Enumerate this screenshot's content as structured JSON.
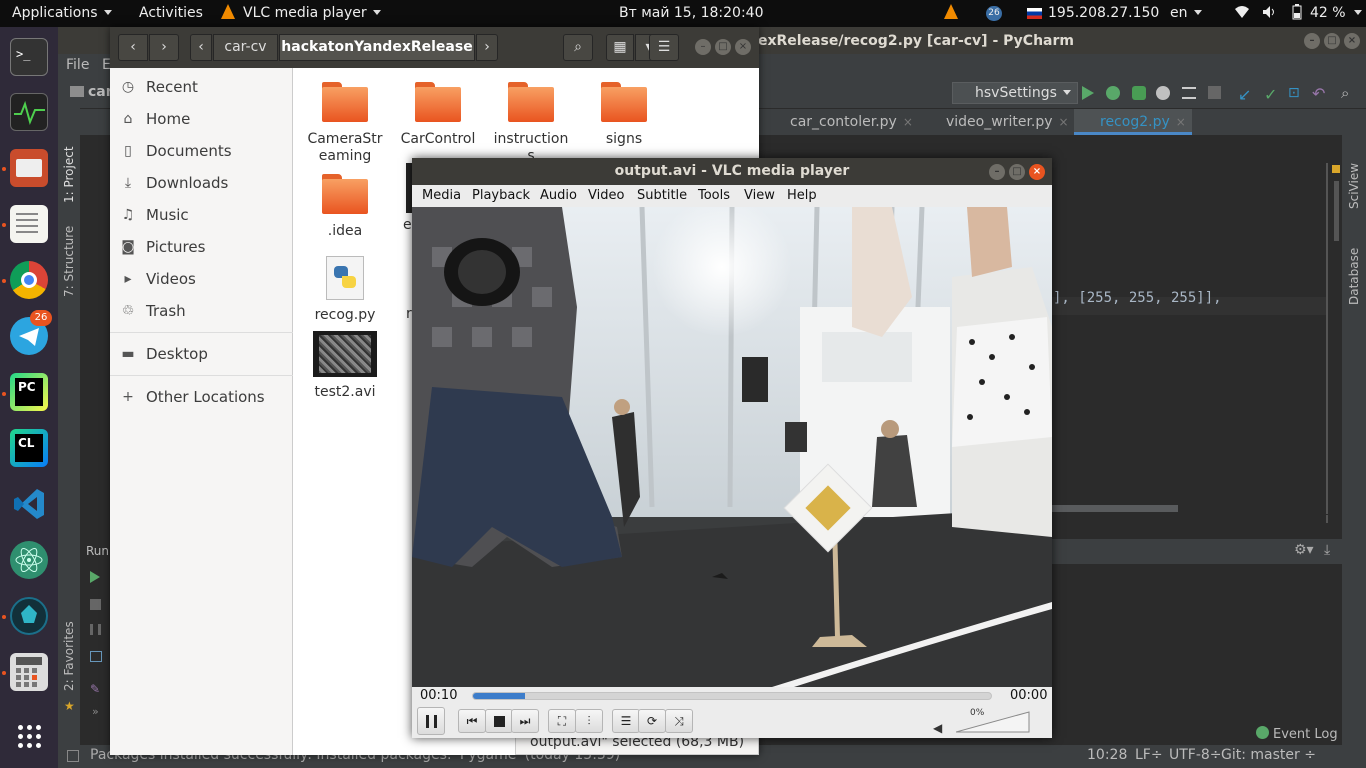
{
  "topbar": {
    "applications": "Applications",
    "activities": "Activities",
    "app_name": "VLC media player",
    "clock": "Вт май 15, 18:20:40",
    "telegram_badge": "26",
    "ip": "195.208.27.150",
    "lang": "en",
    "battery": "42 %"
  },
  "dock": {
    "telegram_badge": "26"
  },
  "pycharm": {
    "title": "exRelease/recog2.py [car-cv] - PyCharm",
    "menu": {
      "file": "File",
      "edit": "E"
    },
    "project_crumb": "car",
    "run_config": "hsvSettings",
    "tabs": [
      "car_contoler.py",
      "video_writer.py",
      "recog2.py"
    ],
    "code_line": "], [255, 255, 255]],",
    "left_tools": {
      "project": "1: Project",
      "structure": "7: Structure",
      "favorites": "2: Favorites",
      "run": "Run"
    },
    "right_tools": {
      "sciview": "SciView",
      "database": "Database"
    },
    "event_log": "Event Log",
    "status": {
      "message": "Packages installed successfully: Installed packages: 'Pygame' (today 15:39)",
      "position": "10:28",
      "line_sep": "LF÷",
      "encoding": "UTF-8÷",
      "git": "Git: master ÷"
    }
  },
  "nautilus": {
    "path": [
      "car-cv",
      "hackatonYandexRelease"
    ],
    "sidebar": [
      {
        "icon": "clock-icon",
        "label": "Recent"
      },
      {
        "icon": "home-icon",
        "label": "Home"
      },
      {
        "icon": "document-icon",
        "label": "Documents"
      },
      {
        "icon": "download-icon",
        "label": "Downloads"
      },
      {
        "icon": "music-icon",
        "label": "Music"
      },
      {
        "icon": "camera-icon",
        "label": "Pictures"
      },
      {
        "icon": "video-icon",
        "label": "Videos"
      },
      {
        "icon": "trash-icon",
        "label": "Trash"
      },
      {
        "icon": "folder-icon",
        "label": "Desktop"
      },
      {
        "icon": "plus-icon",
        "label": "Other Locations"
      }
    ],
    "files": {
      "f1a": "CameraStr",
      "f1b": "eaming",
      "f2": "CarControl",
      "f3a": "instruction",
      "f3b": "s",
      "f4": "signs",
      "f5": ".idea",
      "f6": "e",
      "f7": "recog.py",
      "f8": "r",
      "f9": "test2.avi"
    },
    "status": "output.avi\"  selected  (68,3 MB)"
  },
  "vlc": {
    "title": "output.avi - VLC media player",
    "menu": [
      "Media",
      "Playback",
      "Audio",
      "Video",
      "Subtitle",
      "Tools",
      "View",
      "Help"
    ],
    "elapsed": "00:10",
    "total": "00:00",
    "progress": 0.1,
    "volume": "0%"
  }
}
